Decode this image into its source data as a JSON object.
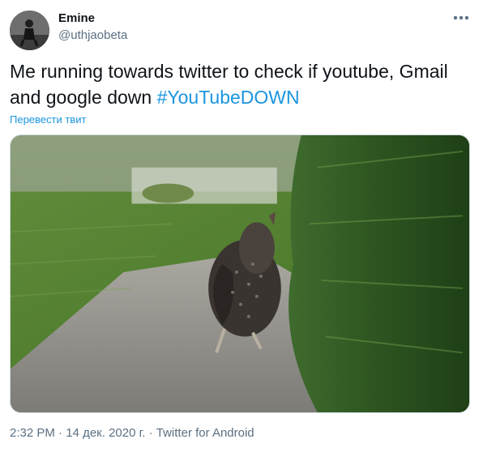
{
  "tweet": {
    "author": {
      "display_name": "Emine",
      "handle": "@uthjaobeta",
      "avatar_icon": "user-avatar-photo"
    },
    "text": "Me running towards twitter to check if youtube, Gmail and google down ",
    "hashtag": "#YouTubeDOWN",
    "translate_label": "Перевести твит",
    "media": {
      "description_icon": "running-chicken-photo"
    },
    "meta": {
      "time": "2:32 PM",
      "separator1": " · ",
      "date": "14 дек. 2020 г.",
      "separator2": " · ",
      "source": "Twitter for Android"
    },
    "more_icon": "more-options-icon"
  },
  "colors": {
    "link": "#1b95e0",
    "secondary_text": "#5b7083",
    "primary_text": "#0f1419"
  }
}
